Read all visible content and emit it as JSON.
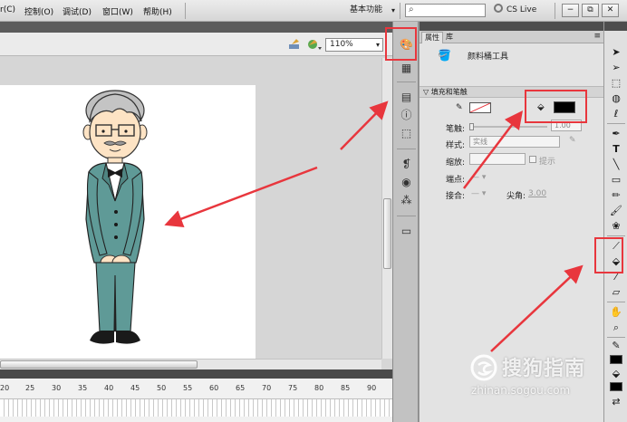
{
  "menubar": {
    "items": [
      "r(C)",
      "控制(O)",
      "调试(D)",
      "窗口(W)",
      "帮助(H)"
    ],
    "workspace": "基本功能",
    "cs_live": "CS Live",
    "window_controls": [
      "−",
      "⧉",
      "✕"
    ]
  },
  "stage": {
    "zoom": "110%"
  },
  "timeline": {
    "frame_labels": [
      "20",
      "25",
      "30",
      "35",
      "40",
      "45",
      "50",
      "55",
      "60",
      "65",
      "70",
      "75",
      "80",
      "85",
      "90"
    ]
  },
  "properties_panel": {
    "tabs": [
      "属性",
      "库"
    ],
    "tool_name": "颜料桶工具",
    "section": "填充和笔触",
    "stroke_label": "笔触:",
    "stroke_value": "1.00",
    "style_label": "样式:",
    "style_value": "实线",
    "scale_label": "缩放:",
    "hint_label": "提示",
    "cap_label": "端点:",
    "join_label": "接合:",
    "miter_label": "尖角:",
    "miter_value": "3.00",
    "fill_color": "#000000",
    "stroke_color": "#ffffff"
  },
  "colors": {
    "highlight": "#e8363d",
    "suit": "#5f9a97",
    "arrow": "#e8363d"
  },
  "watermark": {
    "logo_text": "搜狗指南",
    "url": "zhinan.sogou.com"
  }
}
